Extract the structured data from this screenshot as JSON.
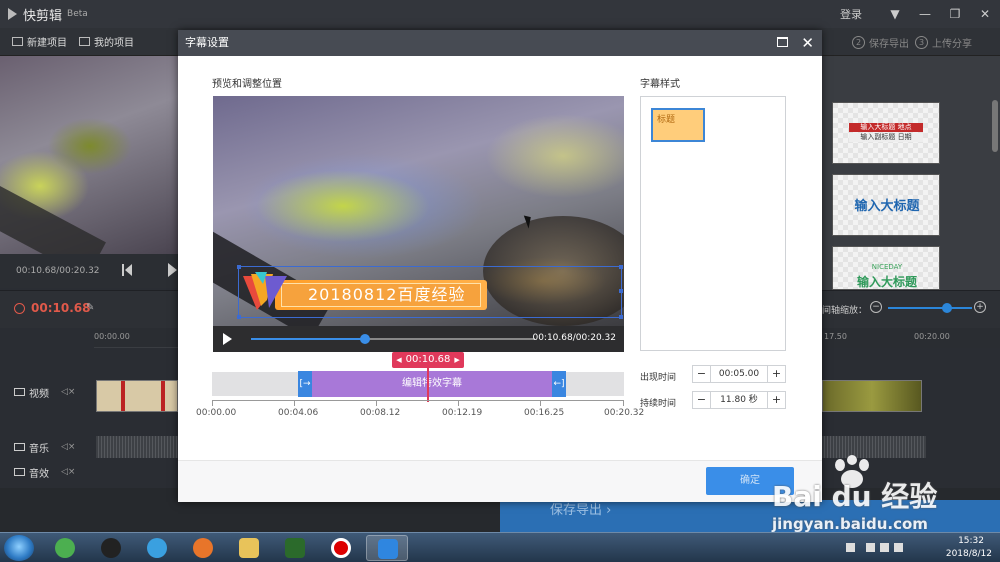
{
  "app": {
    "name": "快剪辑",
    "badge": "Beta"
  },
  "titlebar": {
    "login": "登录",
    "menu": "▼",
    "minimize": "—",
    "maximize": "❐",
    "close": "✕"
  },
  "toolbar": {
    "new_project": "新建项目",
    "my_projects": "我的项目",
    "step2_num": "2",
    "step2": "保存导出",
    "step3_num": "3",
    "step3": "上传分享"
  },
  "left_preview": {
    "time": "00:10.68/00:20.32"
  },
  "timeline": {
    "current": "00:10.68",
    "ruler_start": "00:00.00",
    "ruler_mid": "17.50",
    "ruler_end": "00:20.00",
    "zoom_label": "间轴缩放：",
    "zoom_minus": "−",
    "zoom_plus": "+",
    "zoom_level": 0.7,
    "tracks": {
      "video": "视频",
      "music": "音乐",
      "sfx": "音效"
    },
    "mute": "◁×"
  },
  "templates": {
    "t1_top": "输入大标题",
    "t1_top_right": "地点",
    "t1_bottom": "输入副标题",
    "t1_bottom_right": "日期",
    "t2": "输入大标题",
    "t3_top": "NICEDAY",
    "t3": "输入大标题"
  },
  "bottom": {
    "export": "保存导出 ›"
  },
  "dialog": {
    "title": "字幕设置",
    "preview_label": "预览和调整位置",
    "style_label": "字幕样式",
    "subtitle_text": "20180812百度经验",
    "player_time": "00:10.68/00:20.32",
    "player_progress": 0.4,
    "playhead_time": "00:10.68",
    "edit_bar_label": "编辑特效字幕",
    "handle_left": "[→",
    "handle_right": "←]",
    "ticks": [
      "00:00.00",
      "00:04.06",
      "00:08.12",
      "00:12.19",
      "00:16.25",
      "00:20.32"
    ],
    "style_item": "标题",
    "appear_label": "出现时间",
    "appear_value": "00:05.00",
    "duration_label": "持续时间",
    "duration_value": "11.80 秒",
    "minus": "−",
    "plus": "+",
    "confirm": "确定"
  },
  "watermark": {
    "brand": "Bai du 经验",
    "url": "jingyan.baidu.com"
  },
  "taskbar": {
    "time": "15:32",
    "date": "2018/8/12"
  },
  "colors": {
    "accent": "#3a8ee8",
    "playhead": "#e0395b",
    "edit_bar": "#a878d8",
    "subtitle_orange": "#f6a23d"
  }
}
